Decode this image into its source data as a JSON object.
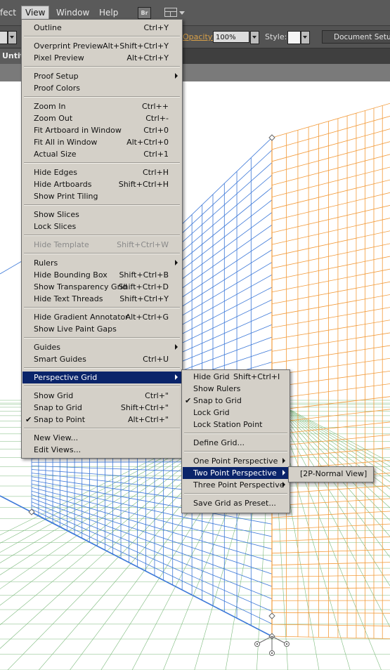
{
  "menubar": {
    "items": [
      {
        "label": "fect",
        "active": false
      },
      {
        "label": "View",
        "active": true
      },
      {
        "label": "Window",
        "active": false
      },
      {
        "label": "Help",
        "active": false
      }
    ],
    "bridge_label": "Br"
  },
  "toolbar": {
    "opacity_label": "Opacity:",
    "opacity_value": "100%",
    "style_label": "Style:",
    "document_setup_label": "Document Setup"
  },
  "doc_tab": {
    "title": "Untit"
  },
  "view_menu": {
    "items": [
      {
        "label": "Outline",
        "shortcut": "Ctrl+Y"
      },
      {
        "sep": true
      },
      {
        "label": "Overprint Preview",
        "shortcut": "Alt+Shift+Ctrl+Y"
      },
      {
        "label": "Pixel Preview",
        "shortcut": "Alt+Ctrl+Y"
      },
      {
        "sep": true
      },
      {
        "label": "Proof Setup",
        "shortcut": "",
        "submenu": true
      },
      {
        "label": "Proof Colors",
        "shortcut": ""
      },
      {
        "sep": true
      },
      {
        "label": "Zoom In",
        "shortcut": "Ctrl++"
      },
      {
        "label": "Zoom Out",
        "shortcut": "Ctrl+-"
      },
      {
        "label": "Fit Artboard in Window",
        "shortcut": "Ctrl+0"
      },
      {
        "label": "Fit All in Window",
        "shortcut": "Alt+Ctrl+0"
      },
      {
        "label": "Actual Size",
        "shortcut": "Ctrl+1"
      },
      {
        "sep": true
      },
      {
        "label": "Hide Edges",
        "shortcut": "Ctrl+H"
      },
      {
        "label": "Hide Artboards",
        "shortcut": "Shift+Ctrl+H"
      },
      {
        "label": "Show Print Tiling",
        "shortcut": ""
      },
      {
        "sep": true
      },
      {
        "label": "Show Slices",
        "shortcut": ""
      },
      {
        "label": "Lock Slices",
        "shortcut": ""
      },
      {
        "sep": true
      },
      {
        "label": "Hide Template",
        "shortcut": "Shift+Ctrl+W",
        "disabled": true
      },
      {
        "sep": true
      },
      {
        "label": "Rulers",
        "shortcut": "",
        "submenu": true
      },
      {
        "label": "Hide Bounding Box",
        "shortcut": "Shift+Ctrl+B"
      },
      {
        "label": "Show Transparency Grid",
        "shortcut": "Shift+Ctrl+D"
      },
      {
        "label": "Hide Text Threads",
        "shortcut": "Shift+Ctrl+Y"
      },
      {
        "sep": true
      },
      {
        "label": "Hide Gradient Annotator",
        "shortcut": "Alt+Ctrl+G"
      },
      {
        "label": "Show Live Paint Gaps",
        "shortcut": ""
      },
      {
        "sep": true
      },
      {
        "label": "Guides",
        "shortcut": "",
        "submenu": true
      },
      {
        "label": "Smart Guides",
        "shortcut": "Ctrl+U"
      },
      {
        "sep": true
      },
      {
        "label": "Perspective Grid",
        "shortcut": "",
        "submenu": true,
        "highlighted": true
      },
      {
        "sep": true
      },
      {
        "label": "Show Grid",
        "shortcut": "Ctrl+\""
      },
      {
        "label": "Snap to Grid",
        "shortcut": "Shift+Ctrl+\""
      },
      {
        "label": "Snap to Point",
        "shortcut": "Alt+Ctrl+\"",
        "checked": true
      },
      {
        "sep": true
      },
      {
        "label": "New View...",
        "shortcut": ""
      },
      {
        "label": "Edit Views...",
        "shortcut": ""
      }
    ]
  },
  "perspective_menu": {
    "items": [
      {
        "label": "Hide Grid",
        "shortcut": "Shift+Ctrl+I"
      },
      {
        "label": "Show Rulers",
        "shortcut": ""
      },
      {
        "label": "Snap to Grid",
        "shortcut": "",
        "checked": true
      },
      {
        "label": "Lock Grid",
        "shortcut": ""
      },
      {
        "label": "Lock Station Point",
        "shortcut": ""
      },
      {
        "sep": true
      },
      {
        "label": "Define Grid...",
        "shortcut": ""
      },
      {
        "sep": true
      },
      {
        "label": "One Point Perspective",
        "shortcut": "",
        "submenu": true
      },
      {
        "label": "Two Point Perspective",
        "shortcut": "",
        "submenu": true,
        "highlighted": true
      },
      {
        "label": "Three Point Perspective",
        "shortcut": "",
        "submenu": true
      },
      {
        "sep": true
      },
      {
        "label": "Save Grid as Preset...",
        "shortcut": ""
      }
    ]
  },
  "two_point_menu": {
    "items": [
      {
        "label": "[2P-Normal View]",
        "shortcut": ""
      }
    ]
  },
  "colors": {
    "left_grid": "#3c78d8",
    "right_grid": "#f39c3c",
    "ground_grid": "#7cba7c",
    "menu_bg": "#d4d0c8",
    "menu_highlight": "#0a246a"
  }
}
